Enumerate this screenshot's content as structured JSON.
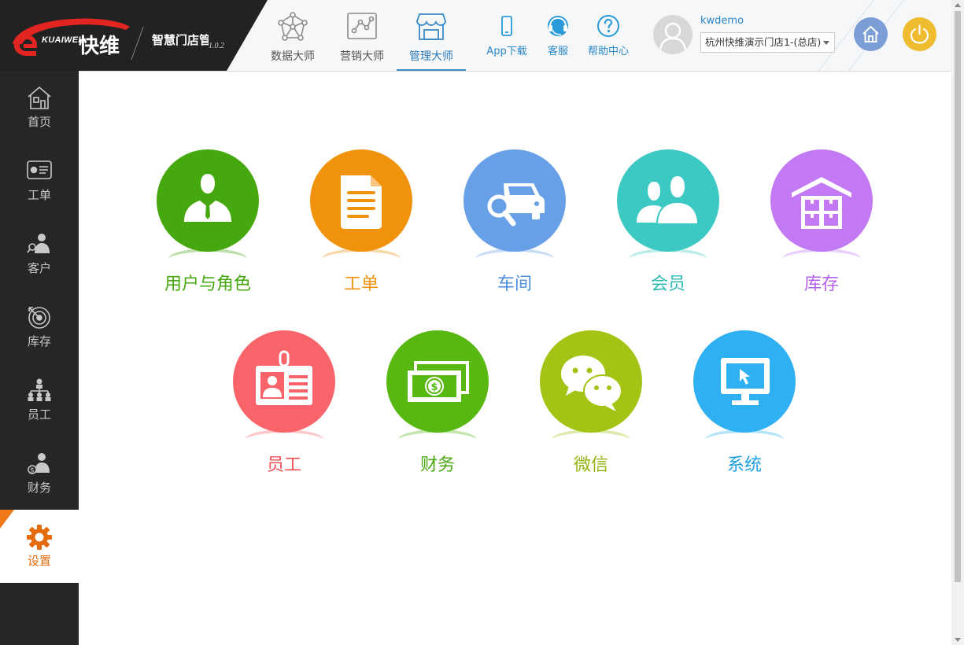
{
  "brand": {
    "en": "KUAIWEI",
    "cn": "快维",
    "product": "智慧门店管理系统",
    "version": "1.0.2"
  },
  "header": {
    "tabs": [
      {
        "label": "数据大师",
        "icon": "data-network-icon"
      },
      {
        "label": "营销大师",
        "icon": "marketing-chart-icon"
      },
      {
        "label": "管理大师",
        "icon": "store-management-icon",
        "active": true
      }
    ],
    "links": [
      {
        "label": "App下载",
        "icon": "mobile-phone-icon"
      },
      {
        "label": "客服",
        "icon": "headset-icon"
      },
      {
        "label": "帮助中心",
        "icon": "question-icon"
      }
    ],
    "username": "kwdemo",
    "store": "杭州快维演示门店1-(总店)"
  },
  "sidebar": {
    "items": [
      {
        "label": "首页",
        "icon": "home-icon"
      },
      {
        "label": "工单",
        "icon": "work-order-icon"
      },
      {
        "label": "客户",
        "icon": "customer-icon"
      },
      {
        "label": "库存",
        "icon": "inventory-target-icon"
      },
      {
        "label": "员工",
        "icon": "org-chart-icon"
      },
      {
        "label": "财务",
        "icon": "finance-icon"
      },
      {
        "label": "设置",
        "icon": "gear-icon",
        "active": true
      }
    ]
  },
  "modules": [
    {
      "label": "用户与角色",
      "icon": "user-role-icon",
      "color": "#46a80f"
    },
    {
      "label": "工单",
      "icon": "document-icon",
      "color": "#f0920c"
    },
    {
      "label": "车间",
      "icon": "car-search-icon",
      "color": "#68a0e8"
    },
    {
      "label": "会员",
      "icon": "members-icon",
      "color": "#3cc9c3"
    },
    {
      "label": "库存",
      "icon": "warehouse-icon",
      "color": "#c378f4"
    },
    {
      "label": "员工",
      "icon": "id-badge-icon",
      "color": "#f8646a"
    },
    {
      "label": "财务",
      "icon": "money-icon",
      "color": "#58b812"
    },
    {
      "label": "微信",
      "icon": "wechat-icon",
      "color": "#a3c414"
    },
    {
      "label": "系统",
      "icon": "monitor-icon",
      "color": "#2fb0f2"
    }
  ]
}
